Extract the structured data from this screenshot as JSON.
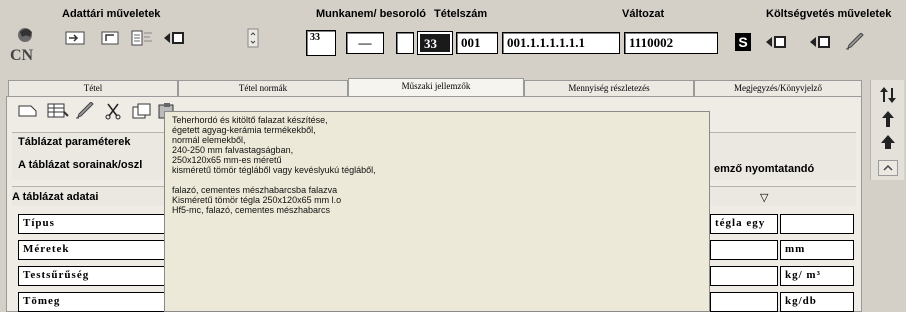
{
  "header": {
    "left_title": "Adattári műveletek",
    "mid_title": "Munkanem/ besoroló",
    "item_title": "Tételszám",
    "variant_title": "Változat",
    "right_title": "Költségvetés műveletek"
  },
  "fields": {
    "f1": "33",
    "f2": "—",
    "f3": "",
    "f4": "33",
    "f5": "001",
    "f6": "001.1.1.1.1.1.1",
    "f7": "1110002",
    "s_badge": "S"
  },
  "tabs": [
    "Tétel",
    "Tétel normák",
    "Műszaki jellemzők",
    "Mennyiség részletezés",
    "Megjegyzés/Könyvjelző"
  ],
  "panel": {
    "table_params": "Táblázat paraméterek",
    "rows_label": "A táblázat sorainak/oszl",
    "print_label": "emző nyomtatandó",
    "table_data": "A táblázat adatai",
    "triangle": "▽"
  },
  "table_rows": [
    {
      "label": "Típus",
      "value": "tégla egy",
      "unit": ""
    },
    {
      "label": "Méretek",
      "value": "",
      "unit": "mm"
    },
    {
      "label": "Testsűrűség",
      "value": "",
      "unit": "kg/ m³"
    },
    {
      "label": "Tömeg",
      "value": "",
      "unit": "kg/db"
    }
  ],
  "tooltip_lines": [
    "Teherhordó és kitöltő falazat készítése,",
    "égetett agyag-kerámia termékekből,",
    "normál elemekből,",
    "240-250 mm falvastagságban,",
    " 250x120x65 mm-es méretű",
    "kisméretű tömör tégláből  vagy  kevéslyukú tégláből,",
    "",
    "falazó, cementes mészhabarcsba falazva",
    "Kisméretű tömör tégla 250x120x65 mm l.o",
    "Hf5-mc, falazó, cementes mészhabarcs"
  ],
  "colors": {
    "background": "#d4d0c8",
    "tooltip_bg": "#ece9d8",
    "field_bg": "#ffffff"
  }
}
